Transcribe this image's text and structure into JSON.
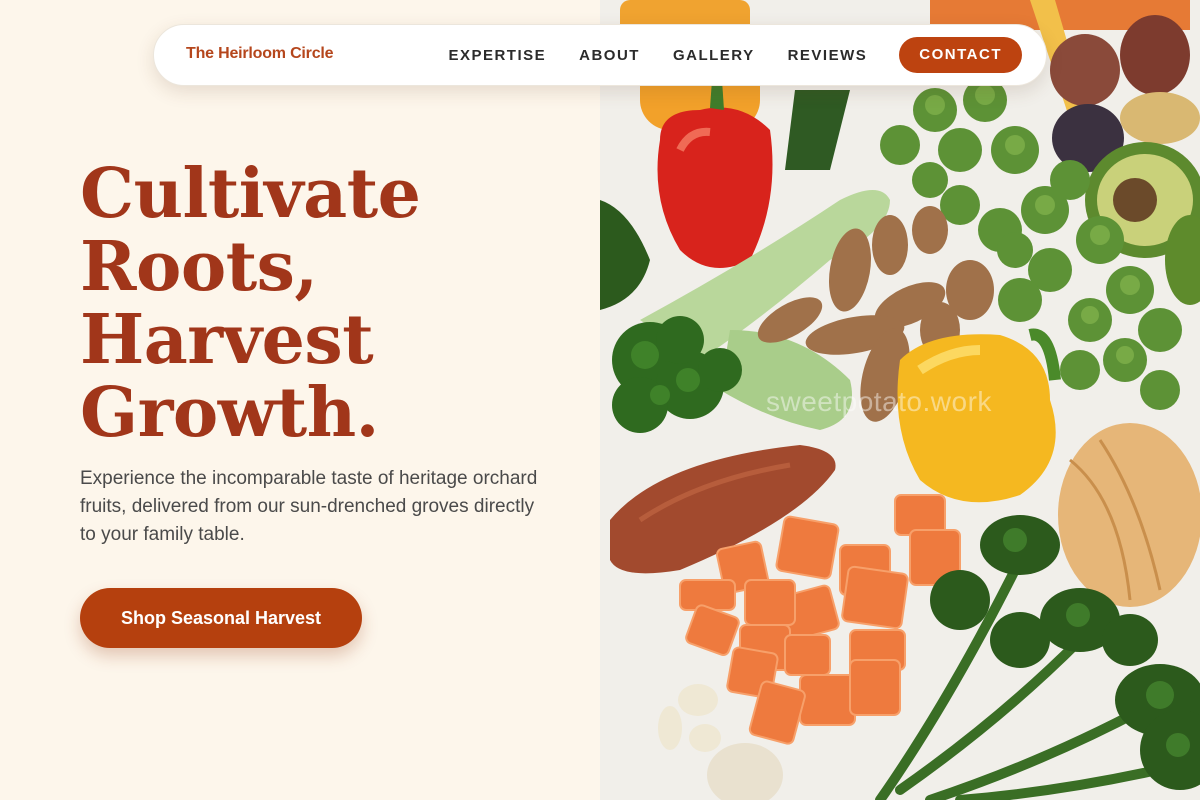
{
  "nav": {
    "brand": "The Heirloom Circle",
    "links": [
      "EXPERTISE",
      "ABOUT",
      "GALLERY",
      "REVIEWS"
    ],
    "contact_label": "CONTACT"
  },
  "hero": {
    "headline_lines": [
      "Cultivate",
      "Roots,",
      "Harvest",
      "Growth."
    ],
    "subtext": "Experience the incomparable taste of heritage orchard fruits, delivered from our sun-drenched groves directly to your family table.",
    "cta_label": "Shop Seasonal Harvest"
  },
  "image": {
    "watermark": "sweetpotato.work"
  },
  "colors": {
    "accent": "#b5400e",
    "headline": "#a1361a",
    "background": "#fdf6eb"
  }
}
